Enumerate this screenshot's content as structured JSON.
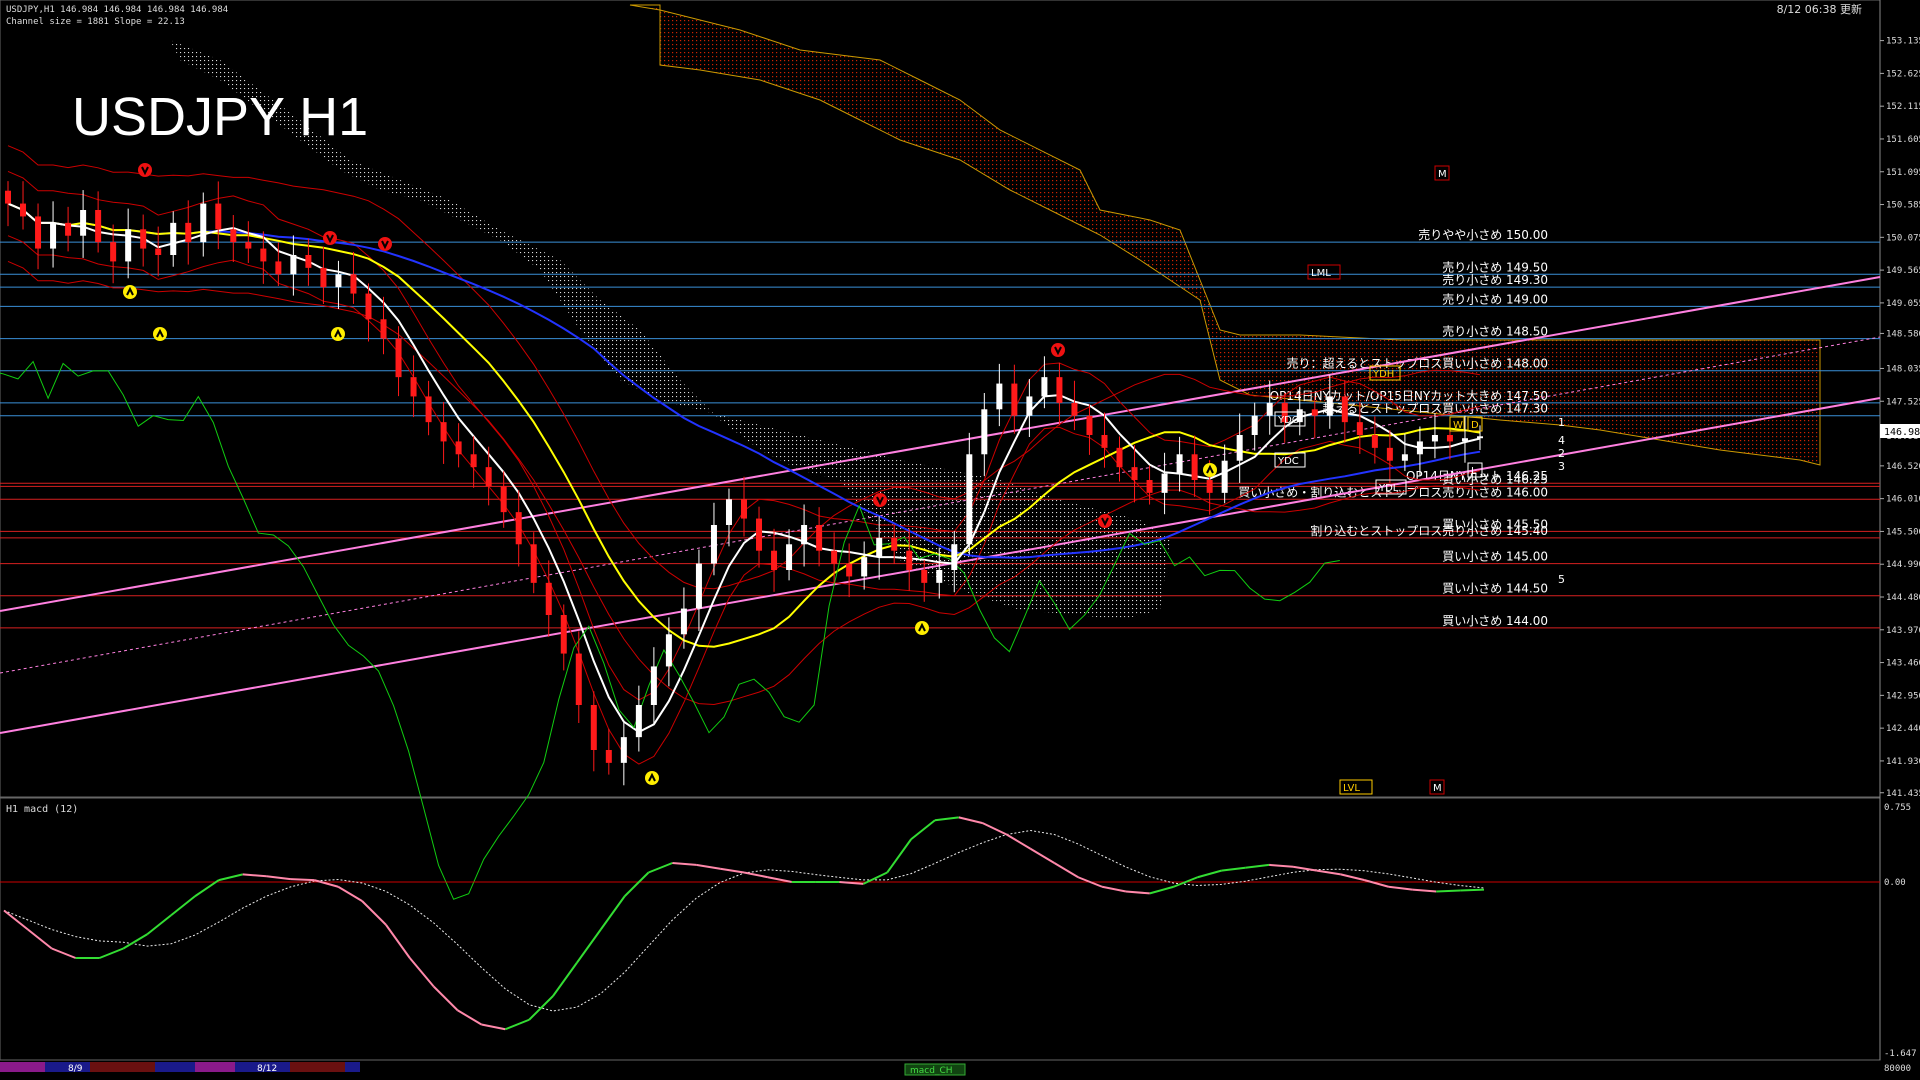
{
  "header": {
    "symbol_line": "USDJPY,H1  146.984 146.984 146.984 146.984",
    "channel_line": "Channel size = 1881 Slope = 22.13",
    "big_title": "USDJPY H1",
    "datetime": "8/12 06:38 更新"
  },
  "colors": {
    "bull": "#ffffff",
    "bear": "#ff1a1a",
    "ma_fast": "#ffffff",
    "ma_mid": "#ffff00",
    "ma_slow": "#2233ff",
    "envelope": "#cc0000",
    "chikou": "#11cc11",
    "channel": "#ff80e0",
    "kumo_red": "#cc2200",
    "kumo_white": "#dddddd",
    "sell_line": "#3a8fd8",
    "buy_line": "#d82020",
    "price_tag_bg": "#ffffff"
  },
  "price_axis": {
    "ticks": [
      "153.135",
      "152.625",
      "152.115",
      "151.605",
      "151.095",
      "150.585",
      "150.075",
      "149.565",
      "149.055",
      "148.580",
      "148.035",
      "147.525",
      "146.984",
      "146.520",
      "146.010",
      "145.500",
      "144.990",
      "144.480",
      "143.970",
      "143.460",
      "142.950",
      "142.440",
      "141.930",
      "141.435"
    ],
    "current": "146.984"
  },
  "labels": [
    {
      "text": "売りやや小さめ 150.00",
      "price": 150.0,
      "side": "sell"
    },
    {
      "text": "売り小さめ 149.50",
      "price": 149.5,
      "side": "sell"
    },
    {
      "text": "売り小さめ 149.30",
      "price": 149.3,
      "side": "sell"
    },
    {
      "text": "売り小さめ 149.00",
      "price": 149.0,
      "side": "sell"
    },
    {
      "text": "売り小さめ 148.50",
      "price": 148.5,
      "side": "sell"
    },
    {
      "text": "売り：超えるとストップロス買い小さめ 148.00",
      "price": 148.0,
      "side": "sell"
    },
    {
      "text": "OP14日NYカット/OP15日NYカット大きめ 147.50",
      "price": 147.5,
      "side": "sell"
    },
    {
      "text": "超えるとストップロス買い小さめ 147.30",
      "price": 147.3,
      "side": "sell"
    },
    {
      "text": "OP14日NYカット 146.25",
      "price": 146.25,
      "side": "buy"
    },
    {
      "text": "買い小さめ 146.25",
      "price": 146.2,
      "side": "buy"
    },
    {
      "text": "買い小さめ・割り込むとストップロス売り小さめ 146.00",
      "price": 146.0,
      "side": "buy"
    },
    {
      "text": "買い小さめ 145.50",
      "price": 145.5,
      "side": "buy"
    },
    {
      "text": "割り込むとストップロス売り小さめ 145.40",
      "price": 145.4,
      "side": "buy"
    },
    {
      "text": "買い小さめ 145.00",
      "price": 145.0,
      "side": "buy"
    },
    {
      "text": "買い小さめ 144.50",
      "price": 144.5,
      "side": "buy"
    },
    {
      "text": "買い小さめ 144.00",
      "price": 144.0,
      "side": "buy"
    }
  ],
  "markers": {
    "M": "M",
    "LML": "LML",
    "LVL": "LVL",
    "YDH": "YDH",
    "YDO": "YDO",
    "YDC": "YDC",
    "YDL": "YDL",
    "W": "W",
    "D": "D",
    "L": "L",
    "wave": [
      "1",
      "4",
      "2",
      "3",
      "5"
    ]
  },
  "macd_panel": {
    "title": "H1  macd (12)",
    "axis_ticks": [
      "0.755",
      "0.00",
      "-1.647"
    ],
    "bottom_tag": "macd_CH"
  },
  "bottom_axis": {
    "dates": [
      "8/9",
      "8/12"
    ],
    "right_value": "80000"
  },
  "chart_data": {
    "type": "candlestick",
    "title": "USDJPY H1",
    "ylim": [
      141.4,
      153.3
    ],
    "levels_sell": [
      150.0,
      149.5,
      149.3,
      149.0,
      148.5,
      148.0,
      147.5,
      147.3
    ],
    "levels_buy": [
      146.25,
      146.2,
      146.0,
      145.5,
      145.4,
      145.0,
      144.5,
      144.0
    ],
    "close_path": [
      150.6,
      150.4,
      149.9,
      150.3,
      150.1,
      150.5,
      150.0,
      149.7,
      150.2,
      149.9,
      149.8,
      150.3,
      150.0,
      150.6,
      150.2,
      150.0,
      149.9,
      149.7,
      149.5,
      149.8,
      149.6,
      149.3,
      149.5,
      149.2,
      148.8,
      148.5,
      147.9,
      147.6,
      147.2,
      146.9,
      146.7,
      146.5,
      146.2,
      145.8,
      145.3,
      144.7,
      144.2,
      143.6,
      142.8,
      142.1,
      141.9,
      142.3,
      142.8,
      143.4,
      143.9,
      144.3,
      145.0,
      145.6,
      146.0,
      145.7,
      145.2,
      144.9,
      145.3,
      145.6,
      145.2,
      145.0,
      144.8,
      145.1,
      145.4,
      145.2,
      144.9,
      144.7,
      144.9,
      145.3,
      146.7,
      147.4,
      147.8,
      147.3,
      147.6,
      147.9,
      147.5,
      147.3,
      147.0,
      146.8,
      146.5,
      146.3,
      146.1,
      146.4,
      146.7,
      146.3,
      146.1,
      146.6,
      147.0,
      147.3,
      147.5,
      147.2,
      147.4,
      147.3,
      147.6,
      147.2,
      147.0,
      146.8,
      146.6,
      146.7,
      146.9,
      147.0,
      146.9,
      146.95,
      146.98
    ],
    "macd": [
      -0.3,
      -0.5,
      -0.7,
      -0.8,
      -0.8,
      -0.7,
      -0.55,
      -0.35,
      -0.15,
      0.02,
      0.08,
      0.06,
      0.03,
      0.02,
      -0.05,
      -0.2,
      -0.45,
      -0.8,
      -1.1,
      -1.35,
      -1.5,
      -1.55,
      -1.45,
      -1.2,
      -0.85,
      -0.5,
      -0.15,
      0.1,
      0.2,
      0.18,
      0.14,
      0.1,
      0.05,
      0.0,
      0.0,
      0.0,
      -0.02,
      0.1,
      0.45,
      0.65,
      0.68,
      0.62,
      0.5,
      0.35,
      0.2,
      0.05,
      -0.05,
      -0.1,
      -0.12,
      -0.05,
      0.05,
      0.12,
      0.15,
      0.18,
      0.16,
      0.12,
      0.08,
      0.02,
      -0.05,
      -0.08,
      -0.1,
      -0.09,
      -0.08
    ]
  }
}
